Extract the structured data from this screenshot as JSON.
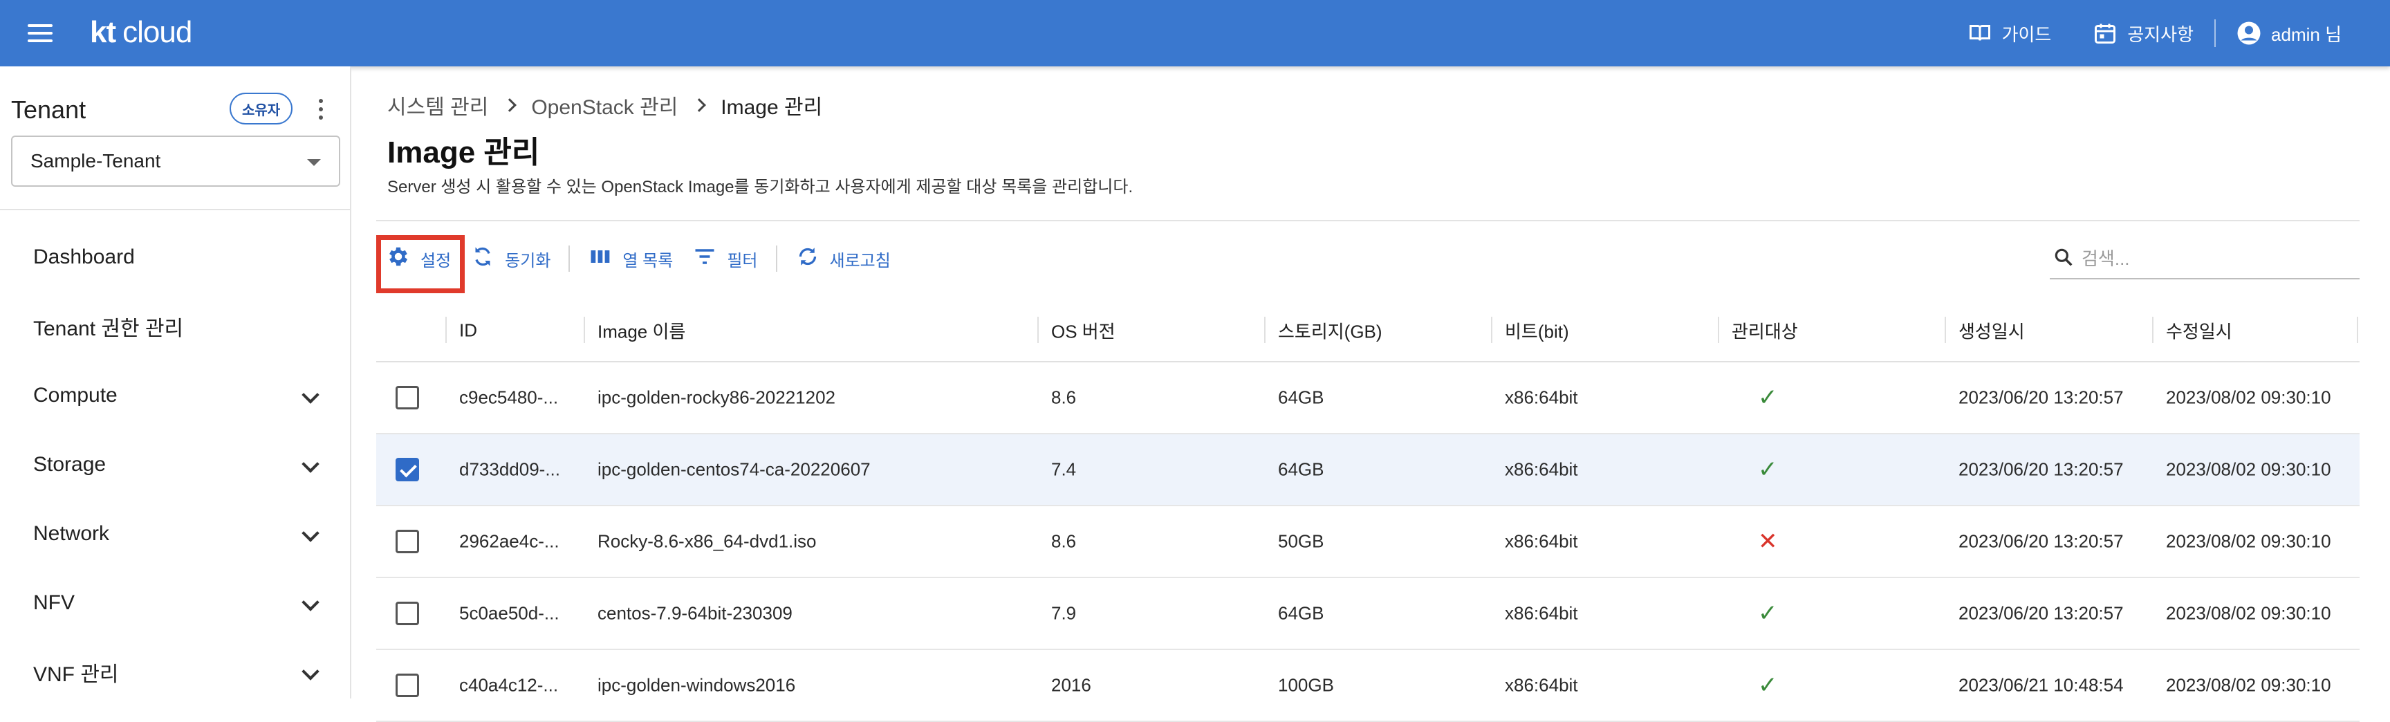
{
  "app": {
    "logo_kt": "kt",
    "logo_cloud": "cloud"
  },
  "topbar": {
    "guide": "가이드",
    "notice": "공지사항",
    "user": "admin 님"
  },
  "sidebar": {
    "tenant_label": "Tenant",
    "owner_badge": "소유자",
    "tenant_selected": "Sample-Tenant",
    "items": [
      {
        "label": "Dashboard",
        "expandable": false
      },
      {
        "label": "Tenant 권한 관리",
        "expandable": false
      },
      {
        "label": "Compute",
        "expandable": true
      },
      {
        "label": "Storage",
        "expandable": true
      },
      {
        "label": "Network",
        "expandable": true
      },
      {
        "label": "NFV",
        "expandable": true
      },
      {
        "label": "VNF 관리",
        "expandable": true
      }
    ]
  },
  "breadcrumb": [
    "시스템 관리",
    "OpenStack 관리",
    "Image 관리"
  ],
  "page": {
    "title": "Image 관리",
    "description": "Server 생성 시 활용할 수 있는 OpenStack Image를 동기화하고 사용자에게 제공할 대상 목록을 관리합니다."
  },
  "toolbar": {
    "settings": "설정",
    "sync": "동기화",
    "columns": "열 목록",
    "filter": "필터",
    "refresh": "새로고침"
  },
  "search": {
    "placeholder": "검색..."
  },
  "table": {
    "headers": [
      "ID",
      "Image 이름",
      "OS 버전",
      "스토리지(GB)",
      "비트(bit)",
      "관리대상",
      "생성일시",
      "수정일시"
    ],
    "rows": [
      {
        "checked": false,
        "id": "c9ec5480-...",
        "name": "ipc-golden-rocky86-20221202",
        "os": "8.6",
        "storage": "64GB",
        "bit": "x86:64bit",
        "managed": true,
        "created": "2023/06/20 13:20:57",
        "updated": "2023/08/02 09:30:10"
      },
      {
        "checked": true,
        "id": "d733dd09-...",
        "name": "ipc-golden-centos74-ca-20220607",
        "os": "7.4",
        "storage": "64GB",
        "bit": "x86:64bit",
        "managed": true,
        "created": "2023/06/20 13:20:57",
        "updated": "2023/08/02 09:30:10"
      },
      {
        "checked": false,
        "id": "2962ae4c-...",
        "name": "Rocky-8.6-x86_64-dvd1.iso",
        "os": "8.6",
        "storage": "50GB",
        "bit": "x86:64bit",
        "managed": false,
        "created": "2023/06/20 13:20:57",
        "updated": "2023/08/02 09:30:10"
      },
      {
        "checked": false,
        "id": "5c0ae50d-...",
        "name": "centos-7.9-64bit-230309",
        "os": "7.9",
        "storage": "64GB",
        "bit": "x86:64bit",
        "managed": true,
        "created": "2023/06/20 13:20:57",
        "updated": "2023/08/02 09:30:10"
      },
      {
        "checked": false,
        "id": "c40a4c12-...",
        "name": "ipc-golden-windows2016",
        "os": "2016",
        "storage": "100GB",
        "bit": "x86:64bit",
        "managed": true,
        "created": "2023/06/21 10:48:54",
        "updated": "2023/08/02 09:30:10"
      }
    ]
  },
  "colors": {
    "primary": "#3a78cf",
    "accent": "#2f6bc7",
    "highlight": "#e03a2b",
    "ok": "#3a8a3a",
    "no": "#d9342b"
  },
  "icons": {
    "ok": "✓",
    "no": "✕"
  }
}
